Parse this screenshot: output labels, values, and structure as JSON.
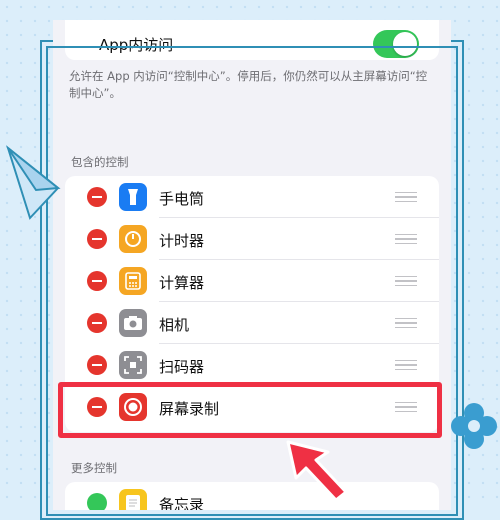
{
  "top_setting": {
    "label": "App内访问",
    "enabled": true
  },
  "description": "允许在 App 内访问“控制中心”。停用后，你仍然可以从主屏幕访问“控制中心”。",
  "included_section": {
    "header": "包含的控制",
    "items": [
      {
        "label": "手电筒",
        "icon": "flashlight-icon",
        "color": "#1a7cf3"
      },
      {
        "label": "计时器",
        "icon": "timer-icon",
        "color": "#f5a623"
      },
      {
        "label": "计算器",
        "icon": "calculator-icon",
        "color": "#f5a623"
      },
      {
        "label": "相机",
        "icon": "camera-icon",
        "color": "#8e8e93"
      },
      {
        "label": "扫码器",
        "icon": "qr-scanner-icon",
        "color": "#8e8e93"
      },
      {
        "label": "屏幕录制",
        "icon": "screen-record-icon",
        "color": "#e5352d"
      }
    ]
  },
  "more_section": {
    "header": "更多控制",
    "items": [
      {
        "label": "备忘录",
        "icon": "notes-icon",
        "color": "#f7c51e"
      }
    ]
  },
  "colors": {
    "highlight": "#ef3044",
    "accent": "#2f8fb5"
  }
}
